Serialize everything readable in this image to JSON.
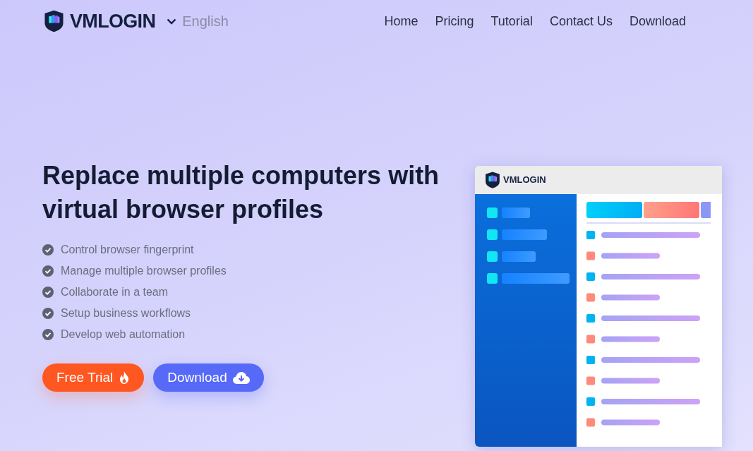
{
  "header": {
    "brand": "VMLOGIN",
    "language": "English",
    "nav": [
      {
        "label": "Home"
      },
      {
        "label": "Pricing"
      },
      {
        "label": "Tutorial"
      },
      {
        "label": "Contact Us"
      },
      {
        "label": "Download"
      }
    ]
  },
  "hero": {
    "title": "Replace multiple computers with virtual browser profiles",
    "features": [
      "Control browser fingerprint",
      "Manage multiple browser profiles",
      "Collaborate in a team",
      "Setup business workflows",
      "Develop web automation"
    ],
    "buttons": [
      {
        "label": "Free Trial",
        "kind": "trial"
      },
      {
        "label": "Download",
        "kind": "download"
      }
    ]
  },
  "preview": {
    "brand": "VMLOGIN"
  }
}
